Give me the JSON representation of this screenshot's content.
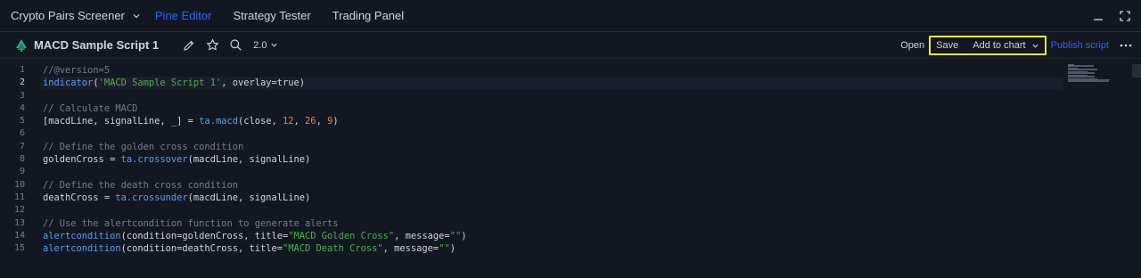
{
  "tabs": [
    {
      "label": "Crypto Pairs Screener",
      "has_dropdown": true,
      "active": false
    },
    {
      "label": "Pine Editor",
      "active": true
    },
    {
      "label": "Strategy Tester",
      "active": false
    },
    {
      "label": "Trading Panel",
      "active": false
    }
  ],
  "toolbar": {
    "script_name": "MACD Sample Script 1",
    "version": "2.0",
    "open_label": "Open",
    "save_label": "Save",
    "add_to_chart_label": "Add to chart",
    "publish_label": "Publish script"
  },
  "colors": {
    "background": "#131722",
    "accent": "#2962ff",
    "highlight_box": "#f0e442",
    "comment": "#787b86",
    "function": "#5b9cf5",
    "string": "#4caf50",
    "number": "#f57c3a"
  },
  "editor": {
    "active_line": 2,
    "line_numbers": [
      "1",
      "2",
      "3",
      "4",
      "5",
      "6",
      "7",
      "8",
      "9",
      "10",
      "11",
      "12",
      "13",
      "14",
      "15"
    ],
    "lines": [
      "//@version=5",
      "indicator('MACD Sample Script 1', overlay=true)",
      "",
      "// Calculate MACD",
      "[macdLine, signalLine, _] = ta.macd(close, 12, 26, 9)",
      "",
      "// Define the golden cross condition",
      "goldenCross = ta.crossover(macdLine, signalLine)",
      "",
      "// Define the death cross condition",
      "deathCross = ta.crossunder(macdLine, signalLine)",
      "",
      "// Use the alertcondition function to generate alerts",
      "alertcondition(condition=goldenCross, title=\"MACD Golden Cross\", message=\"\")",
      "alertcondition(condition=deathCross, title=\"MACD Death Cross\", message=\"\")"
    ]
  },
  "icons": {
    "logo": "pine-logo-icon",
    "rename": "pencil-icon",
    "favorite": "star-icon",
    "search": "search-icon",
    "more": "more-dots-icon",
    "minimize": "minimize-icon",
    "maximize": "maximize-icon"
  }
}
